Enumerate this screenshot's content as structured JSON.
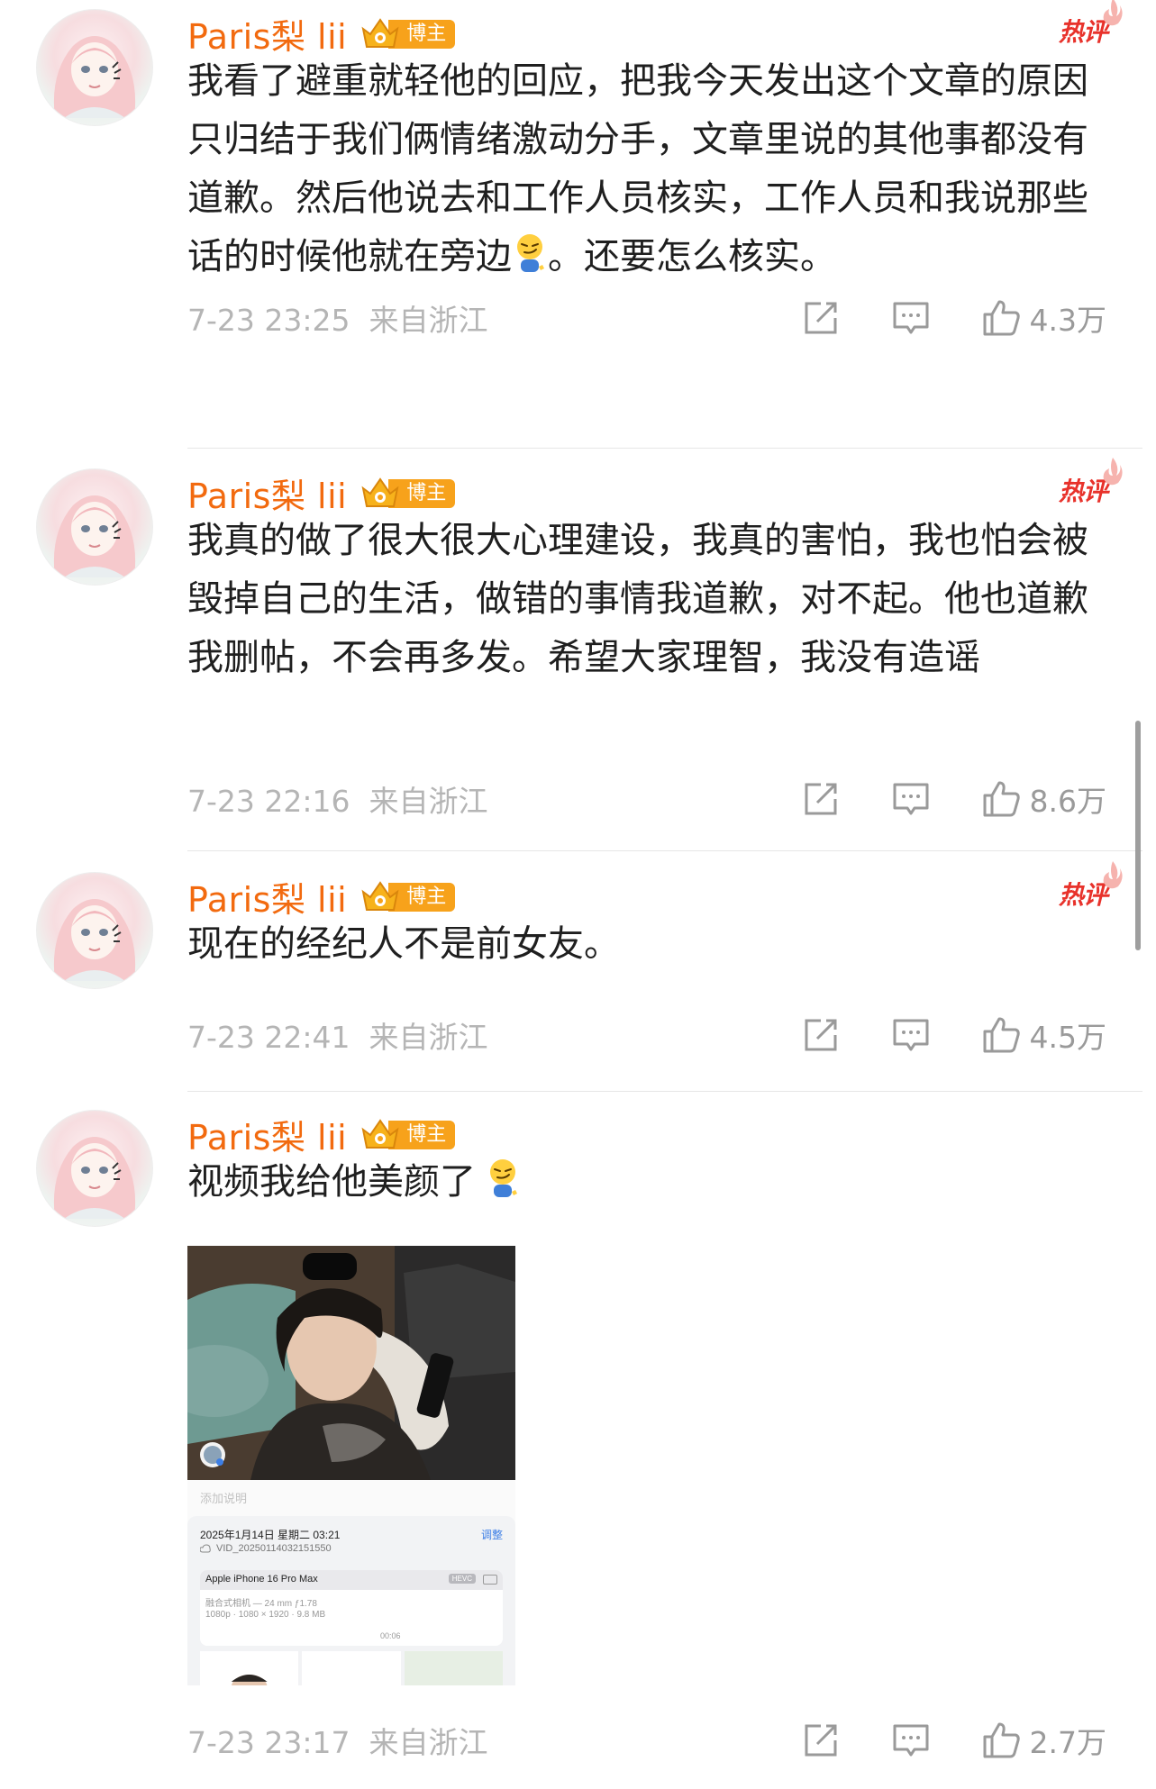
{
  "comments": [
    {
      "username": "Paris梨 lii",
      "badge": "博主",
      "hot_label": "热评",
      "text_before_emoji": "我看了避重就轻他的回应，把我今天发出这个文章的原因只归结于我们俩情绪激动分手，文章里说的其他事都没有道歉。然后他说去和工作人员核实，工作人员和我说那些话的时候他就在旁边",
      "text_after_emoji": "。还要怎么核实。",
      "emoji": "smirk-emoji",
      "time": "7-23 23:25",
      "location": "来自浙江",
      "likes": "4.3万"
    },
    {
      "username": "Paris梨 lii",
      "badge": "博主",
      "hot_label": "热评",
      "text": "我真的做了很大很大心理建设，我真的害怕，我也怕会被毁掉自己的生活，做错的事情我道歉，对不起。他也道歉我删帖，不会再多发。希望大家理智，我没有造谣",
      "time": "7-23 22:16",
      "location": "来自浙江",
      "likes": "8.6万"
    },
    {
      "username": "Paris梨 lii",
      "badge": "博主",
      "hot_label": "热评",
      "text": "现在的经纪人不是前女友。",
      "time": "7-23 22:41",
      "location": "来自浙江",
      "likes": "4.5万"
    },
    {
      "username": "Paris梨 lii",
      "badge": "博主",
      "text": "视频我给他美颜了",
      "emoji": "smirk-emoji",
      "time": "7-23 23:17",
      "location": "来自浙江",
      "likes": "2.7万",
      "media_info": {
        "caption": "添加说明",
        "date": "2025年1月14日 星期二 03:21",
        "adjust": "调整",
        "file": "VID_20250114032151550",
        "model": "Apple iPhone 16 Pro Max",
        "codec": "HEVC",
        "lens": "融合式相机 — 24 mm ƒ1.78",
        "resolution": "1080p · 1080 × 1920 · 9.8 MB",
        "duration": "00:06"
      }
    }
  ],
  "colors": {
    "username": "#f26a0f",
    "badge": "#f7a21b",
    "hot": "#e8322b",
    "meta": "#b5b5b5"
  },
  "icons": {
    "share": "share-icon",
    "reply": "comment-icon",
    "like": "thumbs-up-icon"
  }
}
